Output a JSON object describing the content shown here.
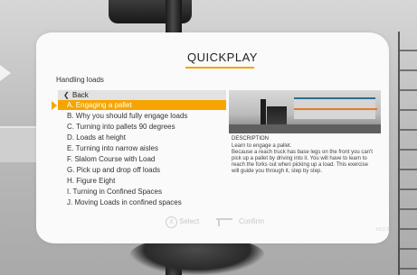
{
  "title": "QUICKPLAY",
  "subtitle": "Handling loads",
  "back_label": "Back",
  "items": [
    "A. Engaging a pallet",
    "B. Why you should fully engage loads",
    "C. Turning into pallets 90 degrees",
    "D. Loads at height",
    "E. Turning into narrow aisles",
    "F. Slalom Course with Load",
    "G. Pick up and drop off loads",
    "H. Figure Eight",
    "I. Turning in Confined Spaces",
    "J. Moving Loads in confined spaces"
  ],
  "selected_index": 0,
  "description": {
    "title": "DESCRIPTION",
    "lines": [
      "Learn to engage a pallet.",
      "Because a reach truck has base legs on the front you can't",
      "pick up a pallet by driving into it. You will have to learn to",
      "reach the forks out when picking up a load. This exercise",
      "will guide you through it, step by step."
    ]
  },
  "footer": {
    "select_label": "Select",
    "select_icon": "X",
    "confirm_label": "Confirm"
  },
  "version": "V3.2.3"
}
